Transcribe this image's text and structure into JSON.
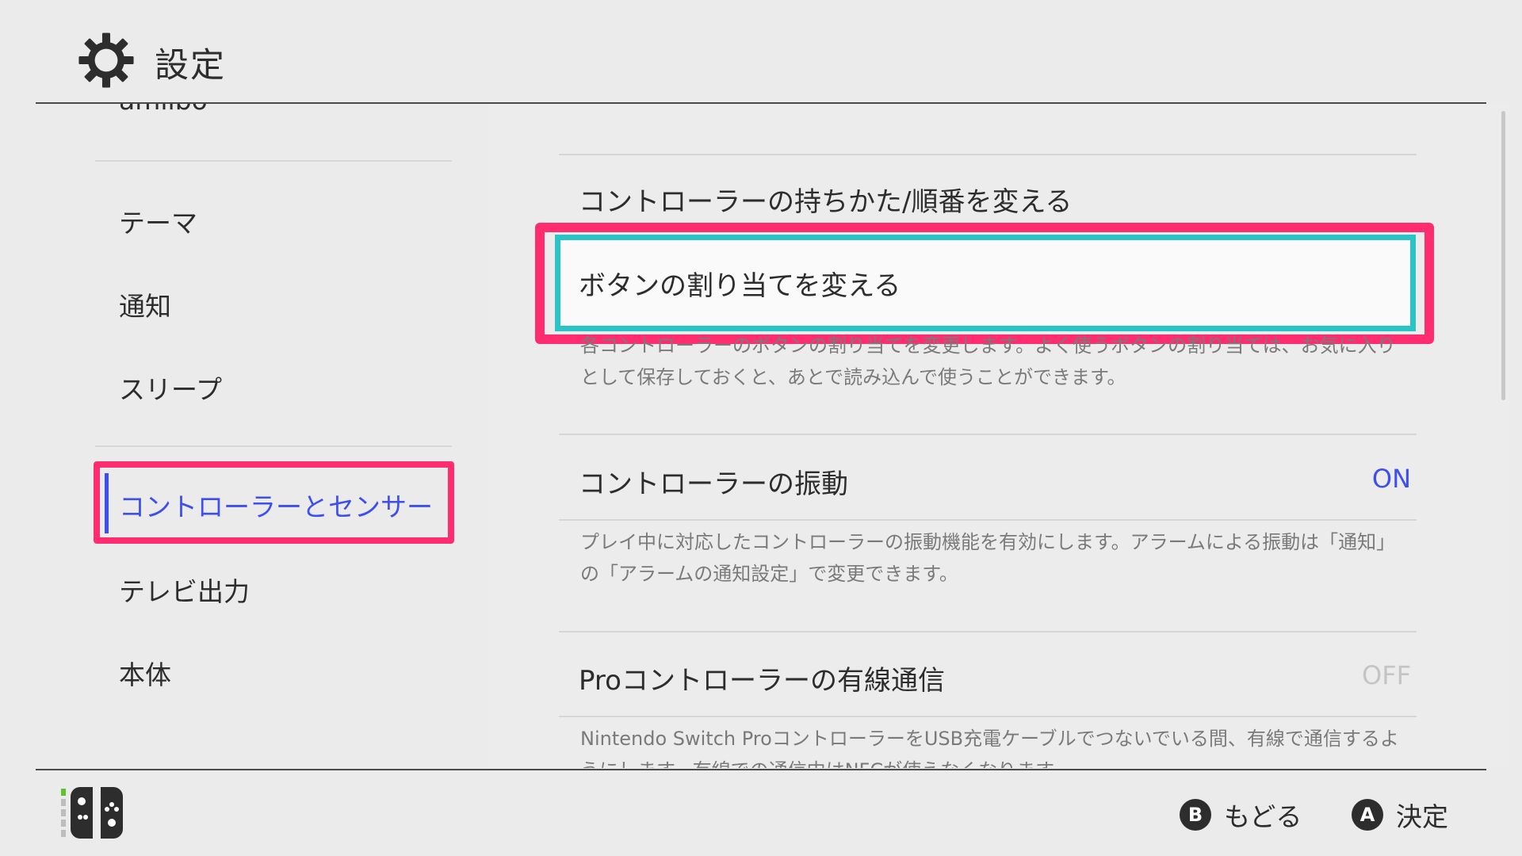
{
  "header": {
    "title": "設定"
  },
  "sidebar": {
    "items": [
      {
        "label": "amiibo"
      },
      {
        "label": "テーマ"
      },
      {
        "label": "通知"
      },
      {
        "label": "スリープ"
      },
      {
        "label": "コントローラーとセンサー"
      },
      {
        "label": "テレビ出力"
      },
      {
        "label": "本体"
      }
    ],
    "selected": "コントローラーとセンサー"
  },
  "main": {
    "items": [
      {
        "label": "コントローラーの持ちかた/順番を変える"
      },
      {
        "label": "ボタンの割り当てを変える",
        "description": "各コントローラーのボタンの割り当てを変更します。よく使うボタンの割り当ては、お気に入りとして保存しておくと、あとで読み込んで使うことができます。"
      },
      {
        "label": "コントローラーの振動",
        "value": "ON",
        "description": "プレイ中に対応したコントローラーの振動機能を有効にします。アラームによる振動は「通知」の「アラームの通知設定」で変更できます。"
      },
      {
        "label": "Proコントローラーの有線通信",
        "value": "OFF",
        "description": "Nintendo Switch ProコントローラーをUSB充電ケーブルでつないでいる間、有線で通信するようにします。有線での通信中はNFCが使えなくなります。"
      }
    ]
  },
  "footer": {
    "back": {
      "button": "B",
      "label": "もどる"
    },
    "confirm": {
      "button": "A",
      "label": "決定"
    }
  },
  "colors": {
    "accent": "#3e4ef0",
    "highlight": "#ff2d6f",
    "cursor": "#2bc4c6",
    "background": "#ebebeb"
  },
  "icons": {
    "header": "gear-icon",
    "footer": "joycon-icon"
  }
}
